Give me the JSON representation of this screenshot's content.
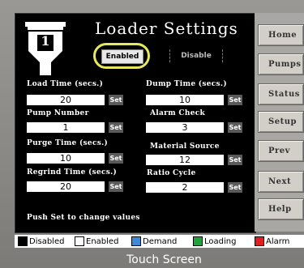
{
  "title": "Loader Settings",
  "loader_number": "1",
  "mode": {
    "enabled_label": "Enabled",
    "disable_label": "Disable"
  },
  "fields": [
    {
      "label": "Load Time (secs.)",
      "value": "20",
      "set": "Set"
    },
    {
      "label": "Dump Time (secs.)",
      "value": "10",
      "set": "Set"
    },
    {
      "label": "Pump Number",
      "value": "1",
      "set": "Set"
    },
    {
      "label": "Alarm Check",
      "value": "3",
      "set": "Set"
    },
    {
      "label": "Purge Time (secs.)",
      "value": "10",
      "set": "Set"
    },
    {
      "label": "Material Source",
      "value": "12",
      "set": "Set"
    },
    {
      "label": "Regrind Time (secs.)",
      "value": "20",
      "set": "Set"
    },
    {
      "label": "Ratio Cycle",
      "value": "2",
      "set": "Set"
    }
  ],
  "hint": "Push Set to change values",
  "nav": [
    "Home",
    "Pumps",
    "Status",
    "Setup",
    "Prev",
    "Next",
    "Help"
  ],
  "legend": [
    {
      "label": "Disabled",
      "color": "#000000"
    },
    {
      "label": "Enabled",
      "color": "#ffffff"
    },
    {
      "label": "Demand",
      "color": "#3a8ad8"
    },
    {
      "label": "Loading",
      "color": "#1fa33a"
    },
    {
      "label": "Alarm",
      "color": "#e02020"
    }
  ],
  "footer": "Touch Screen"
}
